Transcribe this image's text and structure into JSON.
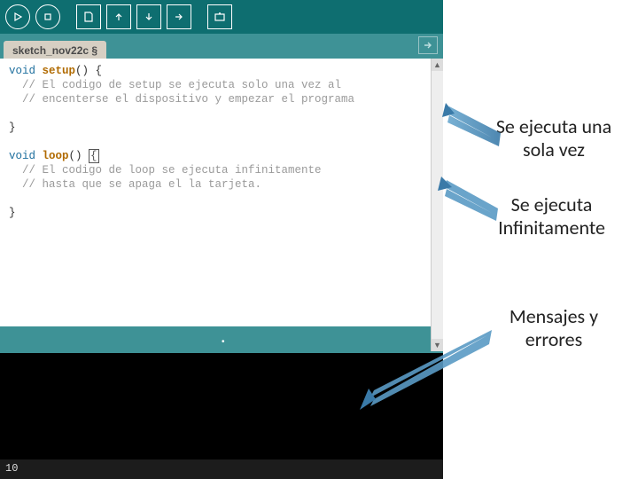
{
  "toolbar": {
    "run": "run",
    "stop": "stop",
    "new": "new",
    "open": "open",
    "save": "save",
    "export": "export",
    "serial": "serial"
  },
  "tab": {
    "name": "sketch_nov22c §"
  },
  "code": {
    "l1_type": "void ",
    "l1_fn": "setup",
    "l1_rest": "() {",
    "l2": "  // El codigo de setup se ejecuta solo una vez al",
    "l3": "  // encenterse el dispositivo y empezar el programa",
    "l4": "}",
    "l5": "",
    "l6_type": "void ",
    "l6_fn": "loop",
    "l6_rest": "() ",
    "l6_cur": "{",
    "l7": "  // El codigo de loop se ejecuta infinitamente",
    "l8": "  // hasta que se apaga el la tarjeta.",
    "l9": "}"
  },
  "footer": {
    "line": "10"
  },
  "annot": {
    "a1": "Se ejecuta una sola vez",
    "a2": "Se ejecuta Infinitamente",
    "a3": "Mensajes y errores"
  }
}
